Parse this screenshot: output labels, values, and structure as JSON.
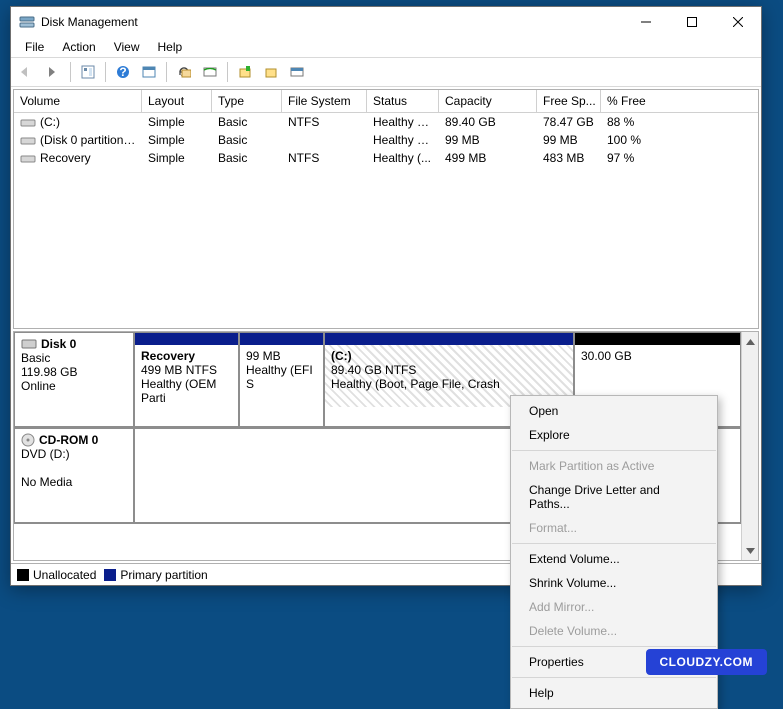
{
  "window": {
    "title": "Disk Management"
  },
  "menu": {
    "file": "File",
    "action": "Action",
    "view": "View",
    "help": "Help"
  },
  "columns": {
    "volume": "Volume",
    "layout": "Layout",
    "type": "Type",
    "fs": "File System",
    "status": "Status",
    "capacity": "Capacity",
    "free": "Free Sp...",
    "pct": "% Free"
  },
  "volumes": [
    {
      "name": "(C:)",
      "layout": "Simple",
      "type": "Basic",
      "fs": "NTFS",
      "status": "Healthy (B...",
      "capacity": "89.40 GB",
      "free": "78.47 GB",
      "pct": "88 %"
    },
    {
      "name": "(Disk 0 partition 2)",
      "layout": "Simple",
      "type": "Basic",
      "fs": "",
      "status": "Healthy (E...",
      "capacity": "99 MB",
      "free": "99 MB",
      "pct": "100 %"
    },
    {
      "name": "Recovery",
      "layout": "Simple",
      "type": "Basic",
      "fs": "NTFS",
      "status": "Healthy (...",
      "capacity": "499 MB",
      "free": "483 MB",
      "pct": "97 %"
    }
  ],
  "disk0": {
    "title": "Disk 0",
    "type": "Basic",
    "size": "119.98 GB",
    "state": "Online",
    "parts": {
      "recovery": {
        "name": "Recovery",
        "line2": "499 MB NTFS",
        "line3": "Healthy (OEM Parti"
      },
      "efi": {
        "name": "",
        "line2": "99 MB",
        "line3": "Healthy (EFI S"
      },
      "c": {
        "name": "(C:)",
        "line2": "89.40 GB NTFS",
        "line3": "Healthy (Boot, Page File, Crash"
      },
      "unalloc": {
        "name": "",
        "line2": "30.00 GB",
        "line3": ""
      }
    }
  },
  "cdrom": {
    "title": "CD-ROM 0",
    "sub": "DVD (D:)",
    "state": "No Media"
  },
  "legend": {
    "unalloc": "Unallocated",
    "primary": "Primary partition"
  },
  "ctx": {
    "open": "Open",
    "explore": "Explore",
    "mark": "Mark Partition as Active",
    "cdl": "Change Drive Letter and Paths...",
    "format": "Format...",
    "extend": "Extend Volume...",
    "shrink": "Shrink Volume...",
    "mirror": "Add Mirror...",
    "delete": "Delete Volume...",
    "props": "Properties",
    "help": "Help"
  },
  "watermark": "CLOUDZY.COM"
}
